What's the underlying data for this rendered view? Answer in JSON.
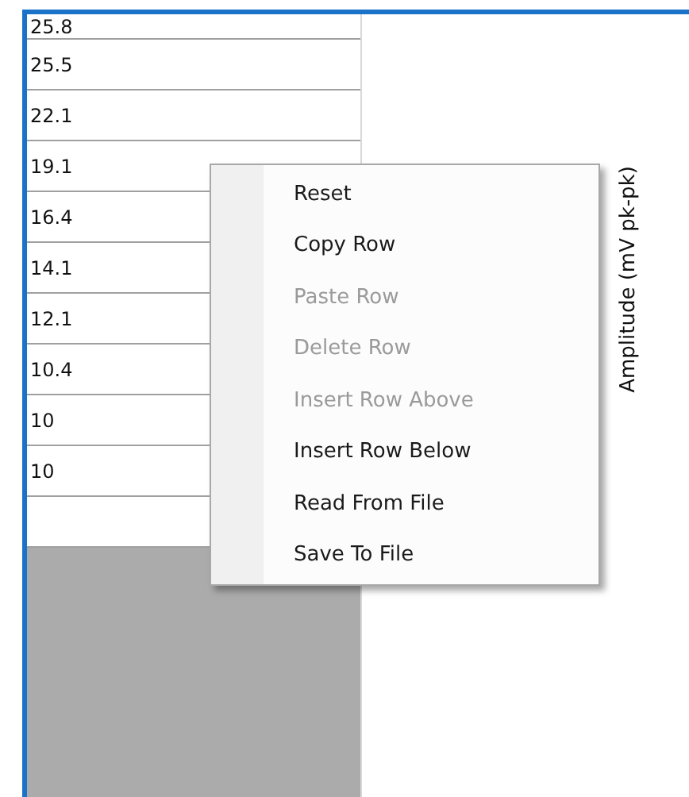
{
  "table": {
    "rows": [
      "25.8",
      "25.5",
      "22.1",
      "19.1",
      "16.4",
      "14.1",
      "12.1",
      "10.4",
      "10",
      "10",
      ""
    ]
  },
  "plot": {
    "ylabel": "Amplitude (mV pk-pk)"
  },
  "context_menu": [
    {
      "label": "Reset",
      "disabled": false
    },
    {
      "label": "Copy Row",
      "disabled": false
    },
    {
      "label": "Paste Row",
      "disabled": true
    },
    {
      "label": "Delete Row",
      "disabled": true
    },
    {
      "label": "Insert Row Above",
      "disabled": true
    },
    {
      "label": "Insert Row Below",
      "disabled": false
    },
    {
      "label": "Read From File",
      "disabled": false
    },
    {
      "label": "Save To File",
      "disabled": false
    }
  ]
}
